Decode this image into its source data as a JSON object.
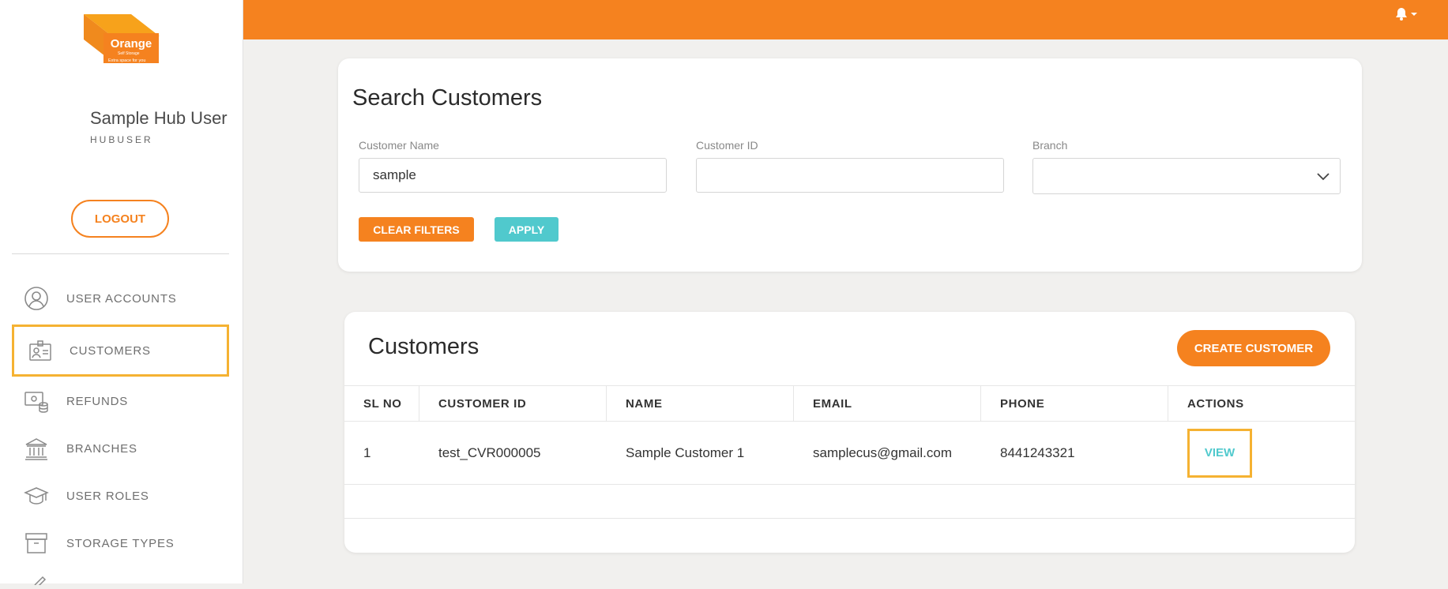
{
  "brand": {
    "logo_text": "Orange",
    "logo_subtext": "Self Storage",
    "logo_tagline": "Extra space for you",
    "primary_color": "#f5821f",
    "secondary_color": "#50c9cd",
    "highlight_color": "#f5b232"
  },
  "user": {
    "name": "Sample Hub User",
    "role": "HUBUSER",
    "logout_label": "LOGOUT"
  },
  "sidebar": {
    "items": [
      {
        "label": "USER ACCOUNTS",
        "icon": "user-circle-icon"
      },
      {
        "label": "CUSTOMERS",
        "icon": "id-card-icon",
        "active": true
      },
      {
        "label": "REFUNDS",
        "icon": "refund-icon"
      },
      {
        "label": "BRANCHES",
        "icon": "bank-icon"
      },
      {
        "label": "USER ROLES",
        "icon": "graduation-cap-icon"
      },
      {
        "label": "STORAGE TYPES",
        "icon": "archive-box-icon"
      }
    ]
  },
  "topbar": {
    "notification_icon": "bell-icon",
    "dropdown_icon": "caret-down-icon"
  },
  "search": {
    "title": "Search Customers",
    "fields": {
      "customer_name": {
        "label": "Customer Name",
        "value": "sample"
      },
      "customer_id": {
        "label": "Customer ID",
        "value": ""
      },
      "branch": {
        "label": "Branch",
        "value": ""
      }
    },
    "clear_label": "CLEAR FILTERS",
    "apply_label": "APPLY"
  },
  "customers": {
    "title": "Customers",
    "create_label": "CREATE CUSTOMER",
    "columns": [
      "SL NO",
      "CUSTOMER ID",
      "NAME",
      "EMAIL",
      "PHONE",
      "ACTIONS"
    ],
    "rows": [
      {
        "sl_no": "1",
        "customer_id": "test_CVR000005",
        "name": "Sample Customer 1",
        "email": "samplecus@gmail.com",
        "phone": "8441243321",
        "action_label": "VIEW"
      }
    ]
  }
}
